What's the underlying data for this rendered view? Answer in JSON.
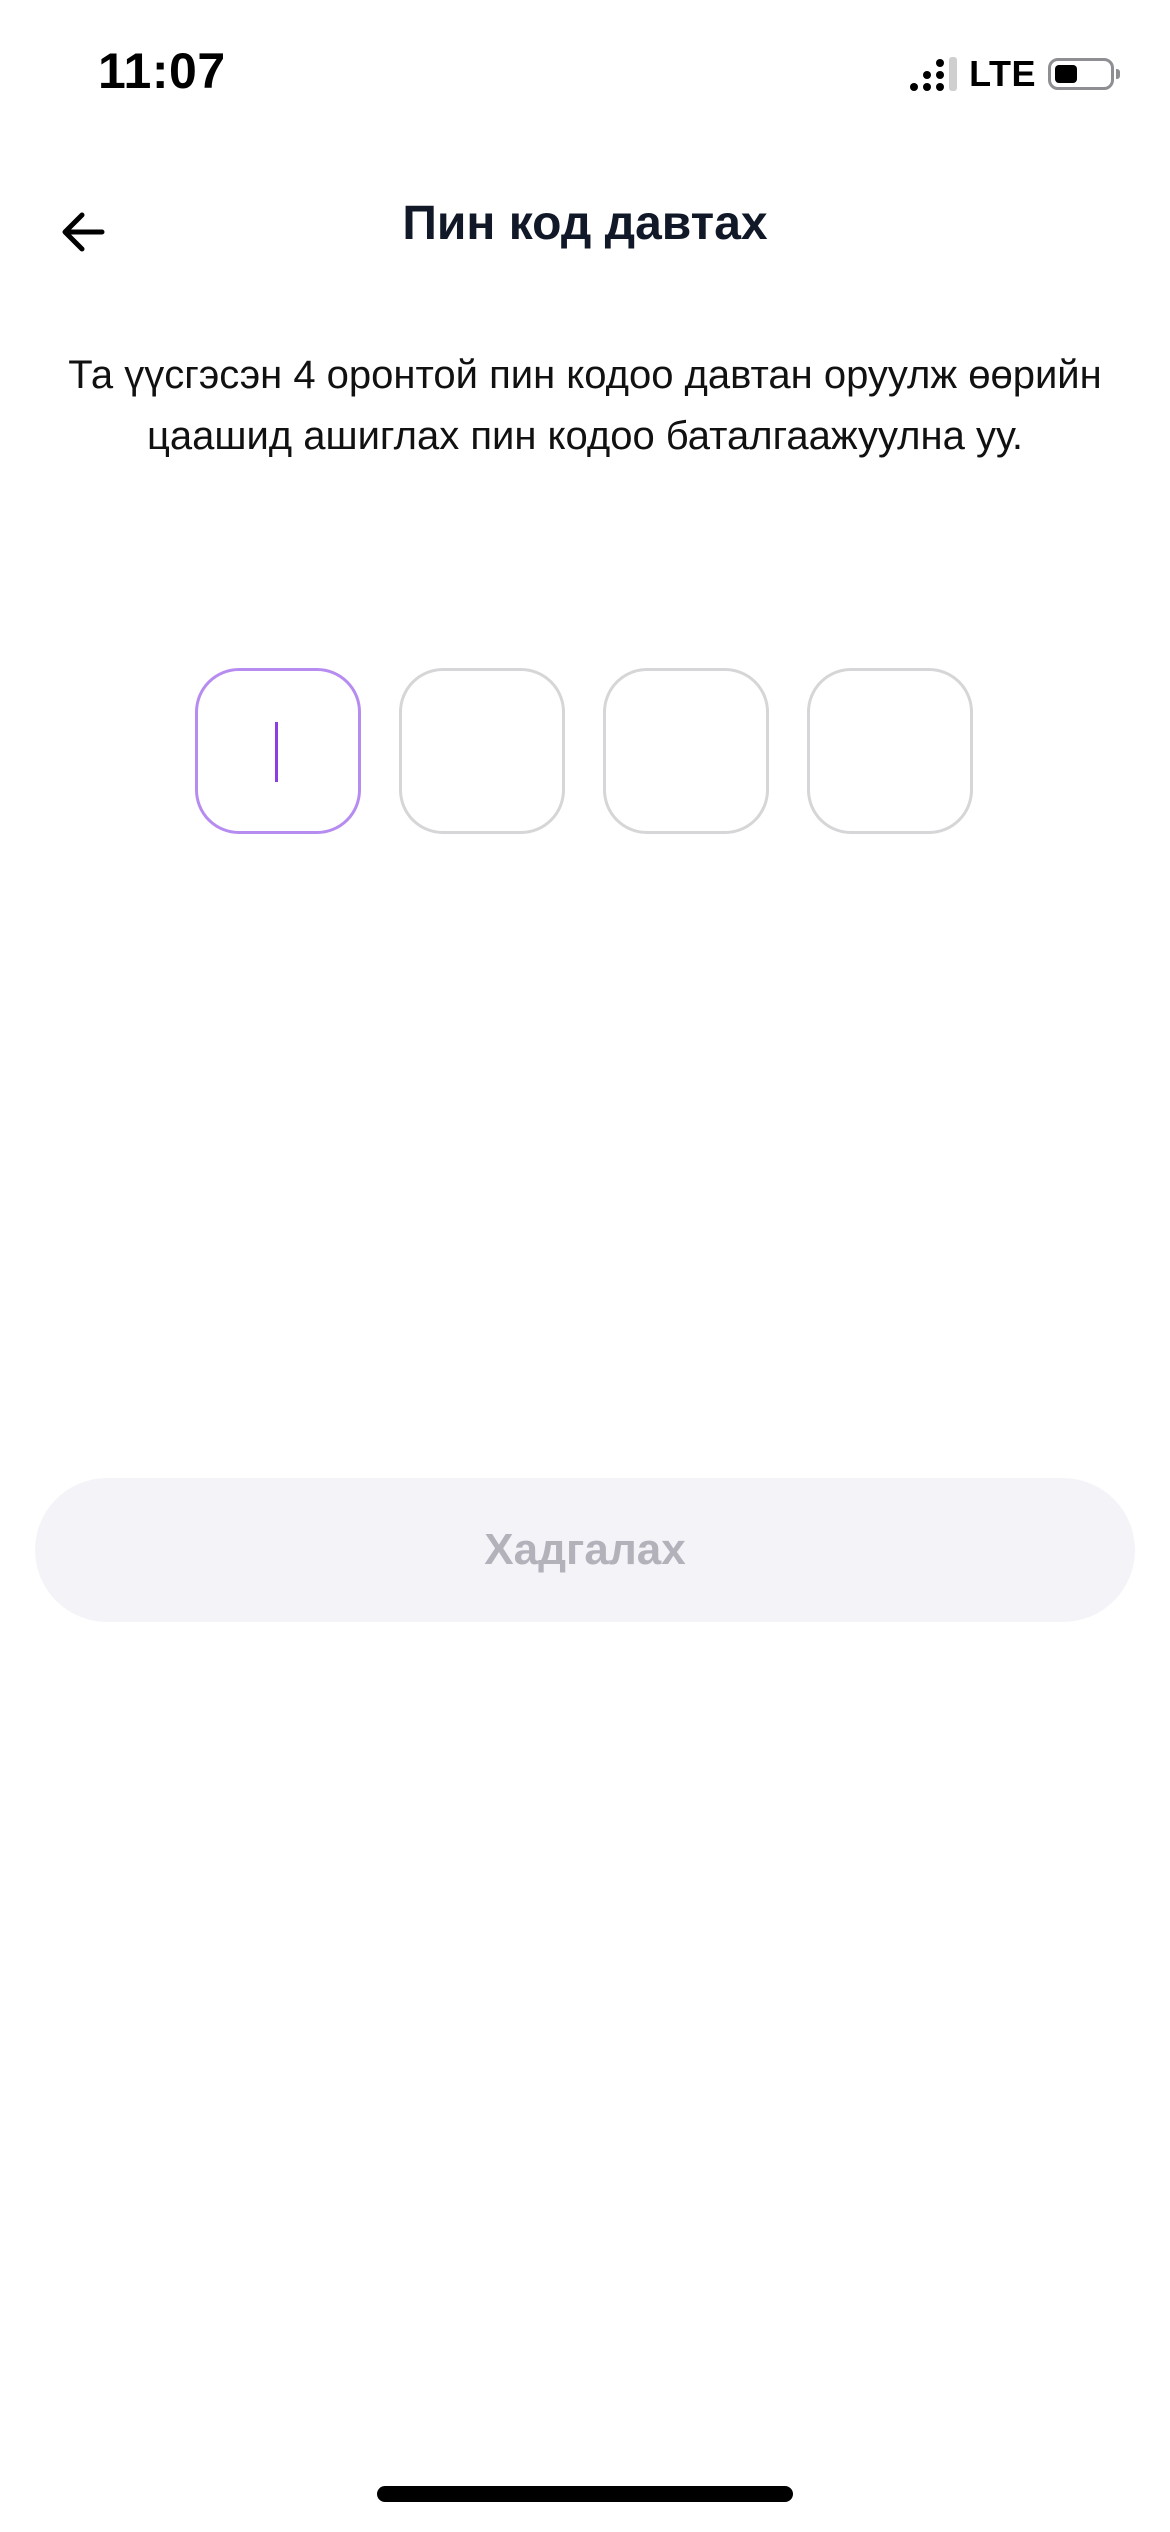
{
  "status_bar": {
    "time": "11:07",
    "network": "LTE"
  },
  "header": {
    "title": "Пин код давтах",
    "back_icon": "arrow-left-icon"
  },
  "description": "Та үүсгэсэн 4 оронтой пин кодоо давтан оруулж өөрийн цаашид ашиглах пин кодоо баталгаажуулна уу.",
  "pin": {
    "length": 4,
    "digits": [
      "",
      "",
      "",
      ""
    ],
    "active_index": 0,
    "active_color": "#b78cf0",
    "caret_color": "#8b3fe0",
    "border_color": "#d6d6d8"
  },
  "save_button": {
    "label": "Хадгалах",
    "enabled": false,
    "background": "#f4f3f8",
    "text_color": "#b3b2bb"
  }
}
